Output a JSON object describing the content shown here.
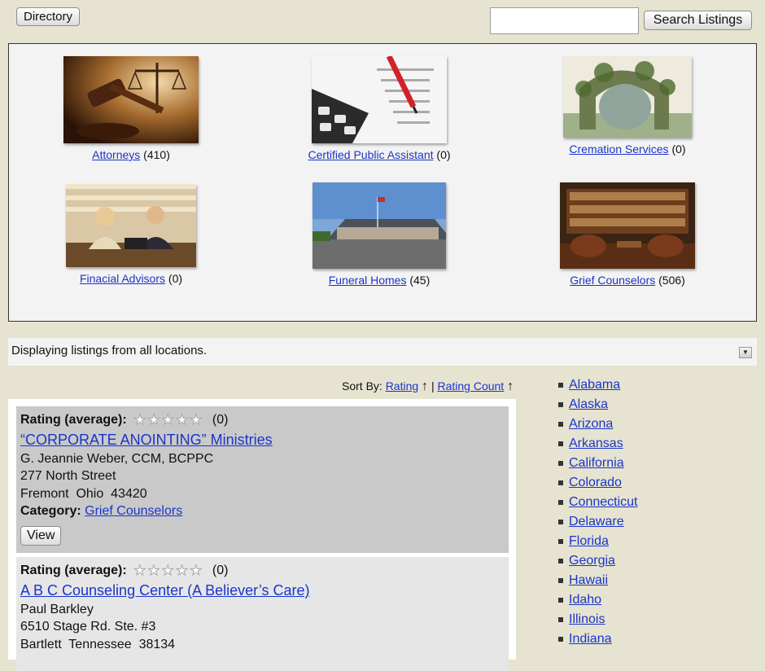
{
  "header": {
    "directory_label": "Directory",
    "search_placeholder": "",
    "search_button_label": "Search Listings"
  },
  "categories": [
    {
      "name": "Attorneys",
      "count": "(410)",
      "image": "gavel-and-scales-photo"
    },
    {
      "name": "Certified Public Assistant",
      "count": "(0)",
      "image": "calculator-and-pen-photo"
    },
    {
      "name": "Cremation Services",
      "count": "(0)",
      "image": "stone-arch-painting"
    },
    {
      "name": "Finacial Advisors",
      "count": "(0)",
      "image": "advisors-meeting-photo"
    },
    {
      "name": "Funeral Homes",
      "count": "(45)",
      "image": "funeral-home-building-photo"
    },
    {
      "name": "Grief Counselors",
      "count": "(506)",
      "image": "library-room-photo"
    }
  ],
  "location": {
    "text": "Displaying listings from all locations."
  },
  "sort": {
    "label": "Sort By:",
    "options": [
      "Rating",
      "Rating Count"
    ],
    "separator": "|",
    "arrow": "↑"
  },
  "listings": [
    {
      "rating_label": "Rating (average):",
      "rating_stars": 0,
      "rating_count": "(0)",
      "title": "“CORPORATE ANOINTING” Ministries",
      "contact": "G. Jeannie Weber, CCM, BCPPC",
      "address": "277 North Street",
      "city_line": "Fremont  Ohio  43420",
      "category_label": "Category:",
      "category": "Grief Counselors",
      "view_label": "View"
    },
    {
      "rating_label": "Rating (average):",
      "rating_stars": 0,
      "rating_count": "(0)",
      "title": "A B C Counseling Center (A Believer’s Care)",
      "contact": "Paul Barkley",
      "address": "6510 Stage Rd. Ste. #3",
      "city_line": "Bartlett  Tennessee  38134"
    }
  ],
  "states": [
    "Alabama",
    "Alaska",
    "Arizona",
    "Arkansas",
    "California",
    "Colorado",
    "Connecticut",
    "Delaware",
    "Florida",
    "Georgia",
    "Hawaii",
    "Idaho",
    "Illinois",
    "Indiana"
  ],
  "colors": {
    "page_bg": "#e6e3d1",
    "link": "#1a35c9",
    "panel_bg": "#f3f3f3",
    "listing_highlight": "#c9c9c9",
    "listing_alt": "#e6e6e6"
  }
}
